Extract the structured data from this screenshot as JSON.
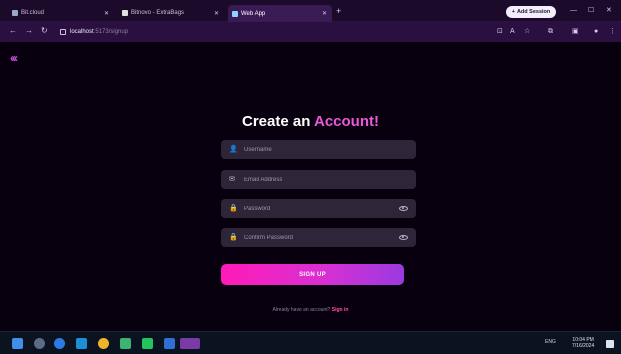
{
  "browser": {
    "tabs": [
      {
        "label": "Bit.cloud",
        "active": false
      },
      {
        "label": "Bitnovo - ExtraBags",
        "active": false
      },
      {
        "label": "Web App",
        "active": true
      }
    ],
    "new_tab_symbol": "+",
    "add_session_label": "Add Session",
    "address": {
      "host": "localhost",
      "path": ":5173/signup"
    }
  },
  "page": {
    "back_symbol": "‹‹‹",
    "title_main": "Create an",
    "title_accent": "Account!",
    "fields": {
      "username": {
        "placeholder": "Username"
      },
      "email": {
        "placeholder": "Email Address"
      },
      "password": {
        "placeholder": "Password"
      },
      "confirm": {
        "placeholder": "Confirm Password"
      }
    },
    "signup_label": "SIGN UP",
    "already_text": "Already have an account?",
    "signin_label": "Sign in",
    "colors": {
      "accent": "#e85ad8",
      "button_start": "#ff1bb8",
      "button_end": "#9a3ae0",
      "background": "#08000f"
    }
  },
  "taskbar": {
    "tray_text": "ENG",
    "time": "10:04 PM",
    "date": "7/16/2024"
  }
}
